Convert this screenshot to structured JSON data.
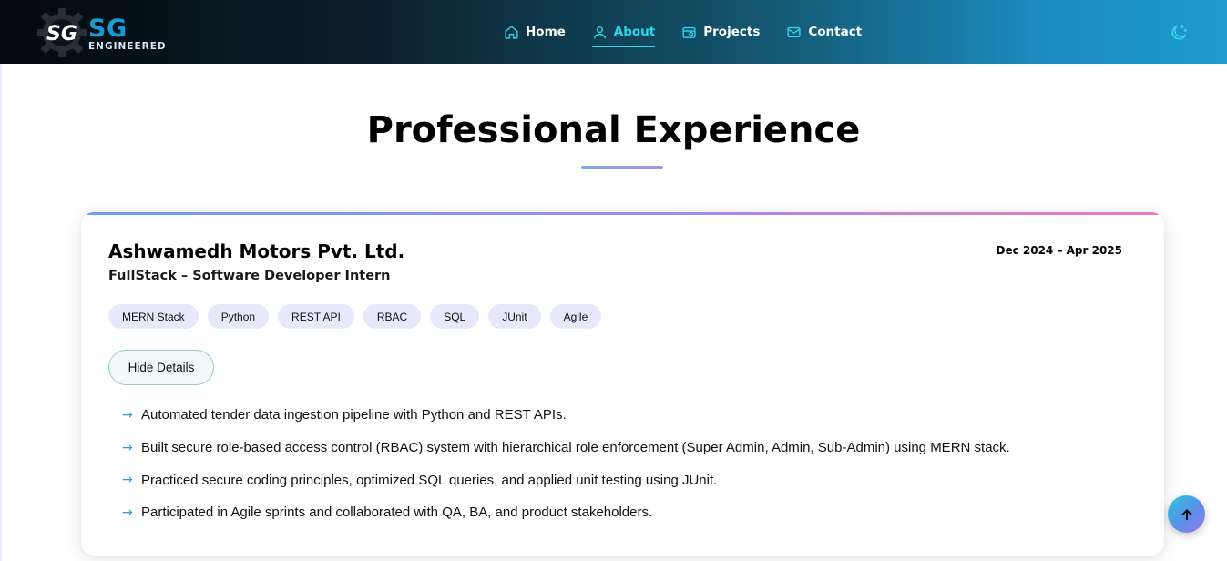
{
  "brand": {
    "mark": "SG",
    "name": "SG",
    "subtitle": "ENGINEERED"
  },
  "nav": {
    "items": [
      {
        "label": "Home",
        "icon": "home-icon",
        "active": false
      },
      {
        "label": "About",
        "icon": "user-icon",
        "active": true
      },
      {
        "label": "Projects",
        "icon": "portfolio-icon",
        "active": false
      },
      {
        "label": "Contact",
        "icon": "mail-icon",
        "active": false
      }
    ],
    "theme_toggle_icon": "moon-stars-icon"
  },
  "section": {
    "title": "Professional Experience"
  },
  "experience": {
    "company": "Ashwamedh Motors Pvt. Ltd.",
    "role": "FullStack – Software Developer Intern",
    "dates": "Dec 2024 – Apr 2025",
    "tags": [
      "MERN Stack",
      "Python",
      "REST API",
      "RBAC",
      "SQL",
      "JUnit",
      "Agile"
    ],
    "toggle_label": "Hide Details",
    "bullet_marker": "→",
    "bullets": [
      "Automated tender data ingestion pipeline with Python and REST APIs.",
      "Built secure role-based access control (RBAC) system with hierarchical role enforcement (Super Admin, Admin, Sub-Admin) using MERN stack.",
      "Practiced secure coding principles, optimized SQL queries, and applied unit testing using JUnit.",
      "Participated in Agile sprints and collaborated with QA, BA, and product stakeholders."
    ]
  },
  "scroll_top_icon": "arrow-up-icon",
  "colors": {
    "accent": "#2fd5ea",
    "brand_blue": "#1a9ad2",
    "tag_bg": "#e7e9fb",
    "bullet_arrow": "#2a9ed0"
  }
}
